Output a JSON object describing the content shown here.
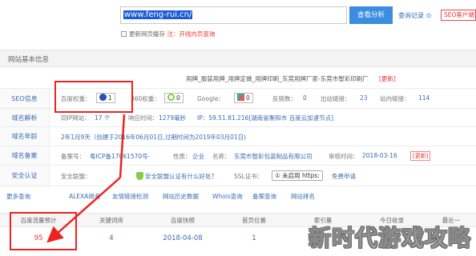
{
  "search": {
    "url": "www.feng-rui.cn/",
    "button": "查看分析",
    "history": "查询记录",
    "seo_client": "SEO客户端下载"
  },
  "cache": {
    "label": "更新网页缓存",
    "note": "注：开线内页查询"
  },
  "section_title": "网站基本信息",
  "site_title": {
    "text": "用牌_服装用牌_用牌定做_用牌印刷_东莞用牌厂家-东莞市智彩印刷厂",
    "more": "[更新]"
  },
  "seo": {
    "label": "SEO信息",
    "baidu_label": "百度权重：",
    "baidu_value": "1",
    "s360_label": "360权重：",
    "s360_value": "0",
    "google_label": "Google：",
    "google_value": "0",
    "backlinks_label": "反链数：",
    "backlinks_value": "0",
    "outlinks_label": "出站链接：",
    "outlinks_value": "23",
    "inlinks_label": "站内链接：",
    "inlinks_value": "114"
  },
  "domain_resolve": {
    "label": "域名解析",
    "same_ip_label": "同IP网站：",
    "same_ip_value": "17 个",
    "response_label": "响应时间：",
    "response_value": "1279毫秒",
    "ip_text": "IP：59.51.81.216[湖南省衡阳市 百度云加速节点]"
  },
  "domain_age": {
    "label": "域名年龄",
    "value": "2年1月9天（创建于2016年06月01日,过期时间为2019年03月01日)"
  },
  "domain_record": {
    "label": "域名备案",
    "record_label": "备案号：",
    "record_value": "粤ICP备17061570号-",
    "nature_label": "性质：",
    "nature_value": "企业",
    "name_label": "名称：",
    "name_value": "东莞市智彩包装制品有限公司",
    "audit_label": "审核时间：",
    "audit_value": "2018-03-16",
    "more": "[更新]"
  },
  "security": {
    "label": "安全认证",
    "safe_label": "安全联盟：",
    "safe_link": "安全联盟认证有什么好处？",
    "ssl_label": "SSL证书：",
    "https_btn": "① 未启用 https:",
    "apply": "免费申请"
  },
  "more_queries": {
    "label": "更多查询",
    "links": [
      "ALEXA排名",
      "友情链接检测",
      "网站历史数据",
      "Whois查询",
      "备案查询",
      "网站排名"
    ]
  },
  "stats": {
    "headers": [
      "百度流量预计",
      "关键词库",
      "百度快照",
      "首页位置",
      "索引量",
      "今日收录",
      "最近一"
    ],
    "values": [
      "95",
      "4",
      "2018-04-08",
      "1",
      "",
      "",
      ""
    ]
  },
  "watermark": "新时代游戏攻略",
  "colors": {
    "accent": "#3b8de0",
    "link": "#3a6cb0",
    "warn": "#e33",
    "highlight": "#e22"
  }
}
